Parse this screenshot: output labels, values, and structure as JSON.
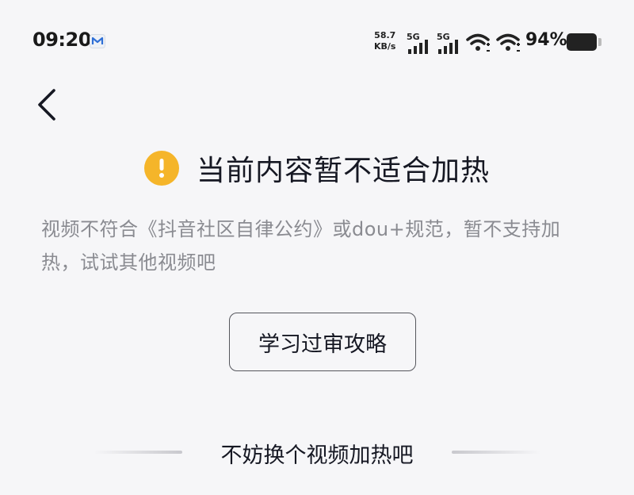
{
  "status_bar": {
    "time": "09:20",
    "net_speed_value": "58.7",
    "net_speed_unit": "KB/s",
    "signal_1_label": "5G",
    "signal_2_label": "5G",
    "battery_percent": "94%"
  },
  "header": {
    "back_icon": "chevron-left-icon"
  },
  "notice": {
    "title": "当前内容暂不适合加热",
    "icon": "warning-icon",
    "icon_color": "#f5b52a",
    "description": "视频不符合《抖音社区自律公约》或dou+规范，暂不支持加热，试试其他视频吧"
  },
  "actions": {
    "guide_button_label": "学习过审攻略"
  },
  "section": {
    "divider_label": "不妨换个视频加热吧"
  }
}
